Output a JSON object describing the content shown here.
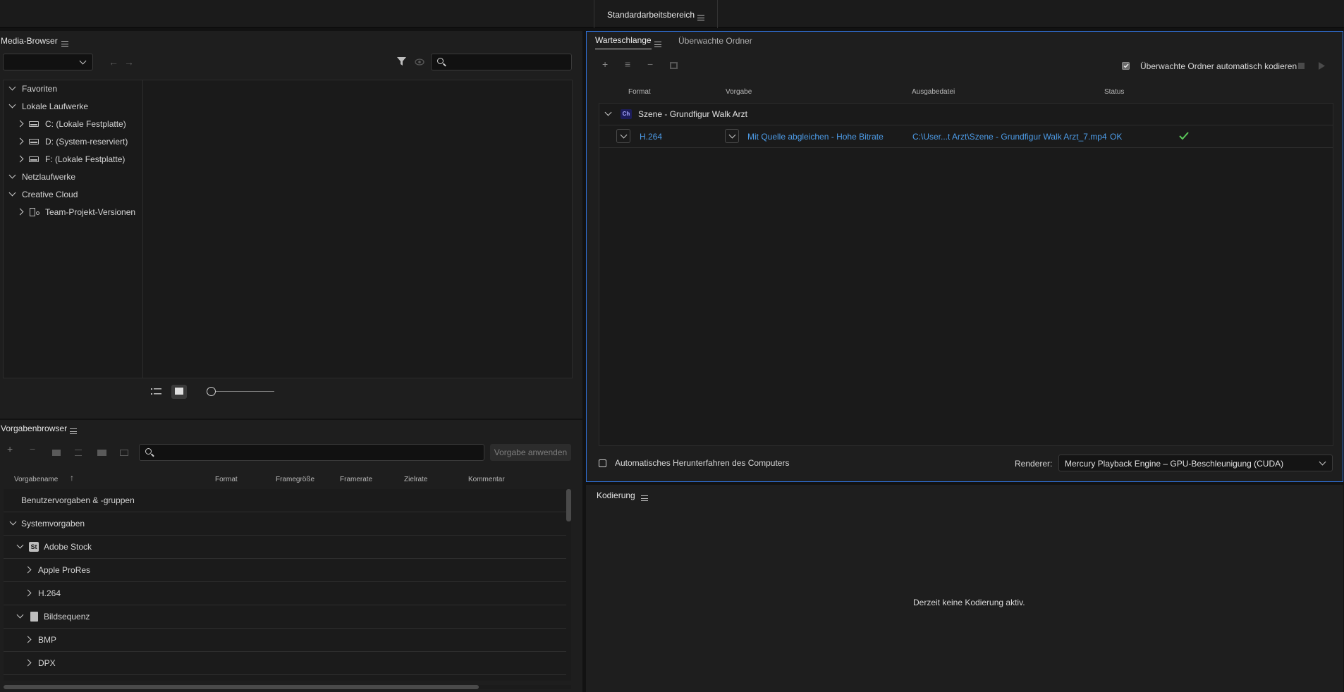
{
  "topbar": {
    "workspace_label": "Standardarbeitsbereich"
  },
  "media_browser": {
    "title": "Media-Browser",
    "tree": [
      {
        "label": "Favoriten",
        "level": 0,
        "expanded": true
      },
      {
        "label": "Lokale Laufwerke",
        "level": 0,
        "expanded": true
      },
      {
        "label": "C: (Lokale Festplatte)",
        "level": 1,
        "expanded": false,
        "icon": "drive-c-icon"
      },
      {
        "label": "D: (System-reserviert)",
        "level": 1,
        "expanded": false,
        "icon": "drive-icon"
      },
      {
        "label": "F: (Lokale Festplatte)",
        "level": 1,
        "expanded": false,
        "icon": "drive-icon"
      },
      {
        "label": "Netzlaufwerke",
        "level": 0,
        "expanded": true
      },
      {
        "label": "Creative Cloud",
        "level": 0,
        "expanded": true
      },
      {
        "label": "Team-Projekt-Versionen",
        "level": 1,
        "expanded": false,
        "icon": "team-project-icon"
      }
    ]
  },
  "preset_browser": {
    "title": "Vorgabenbrowser",
    "apply_button": "Vorgabe anwenden",
    "columns": [
      "Vorgabename",
      "Format",
      "Framegröße",
      "Framerate",
      "Zielrate",
      "Kommentar"
    ],
    "rows": [
      {
        "label": "Benutzervorgaben & -gruppen",
        "level": 0,
        "expander": "none"
      },
      {
        "label": "Systemvorgaben",
        "level": 0,
        "expander": "down"
      },
      {
        "label": "Adobe Stock",
        "level": 1,
        "expander": "down",
        "icon": "St"
      },
      {
        "label": "Apple ProRes",
        "level": 2,
        "expander": "right"
      },
      {
        "label": "H.264",
        "level": 2,
        "expander": "right"
      },
      {
        "label": "Bildsequenz",
        "level": 1,
        "expander": "down",
        "icon": "image-sequence-icon"
      },
      {
        "label": "BMP",
        "level": 2,
        "expander": "right"
      },
      {
        "label": "DPX",
        "level": 2,
        "expander": "right"
      }
    ]
  },
  "queue": {
    "tabs": [
      "Warteschlange",
      "Überwachte Ordner"
    ],
    "auto_encode_label": "Überwachte Ordner automatisch kodieren",
    "auto_encode_checked": true,
    "columns": [
      "Format",
      "Vorgabe",
      "Ausgabedatei",
      "Status"
    ],
    "item": {
      "badge": "Ch",
      "name": "Szene - Grundfigur Walk Arzt",
      "format": "H.264",
      "preset": "Mit Quelle abgleichen - Hohe Bitrate",
      "output": "C:\\User...t Arzt\\Szene - Grundfigur Walk Arzt_7.mp4",
      "status": "OK"
    },
    "shutdown_label": "Automatisches Herunterfahren des Computers",
    "renderer_label": "Renderer:",
    "renderer_value": "Mercury Playback Engine – GPU-Beschleunigung (CUDA)"
  },
  "encoding": {
    "title": "Kodierung",
    "empty_message": "Derzeit keine Kodierung aktiv."
  },
  "colors": {
    "accent": "#2f6fd6",
    "link": "#4d9ce8",
    "ok": "#5ac85a"
  }
}
